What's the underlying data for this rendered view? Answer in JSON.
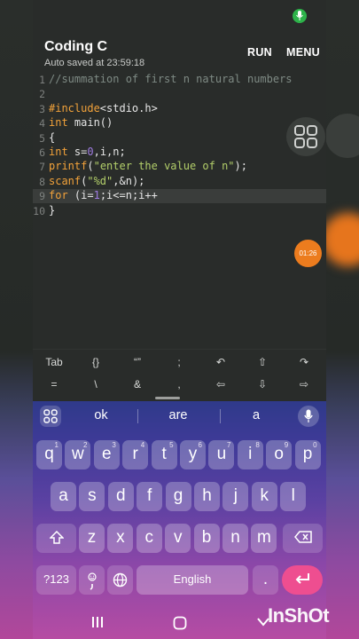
{
  "app": {
    "title": "Coding C",
    "autosave": "Auto saved at 23:59:18",
    "run_label": "RUN",
    "menu_label": "MENU",
    "accent": "#f2a23a"
  },
  "editor": {
    "active_line": 9,
    "lines": [
      {
        "n": "1",
        "segments": [
          {
            "t": "//summation of first n natural numbers",
            "c": "comment"
          }
        ]
      },
      {
        "n": "2",
        "segments": []
      },
      {
        "n": "3",
        "segments": [
          {
            "t": "#include",
            "c": "keyword"
          },
          {
            "t": "<stdio.h>",
            "c": "text"
          }
        ]
      },
      {
        "n": "4",
        "segments": [
          {
            "t": "int",
            "c": "keyword"
          },
          {
            "t": " main()",
            "c": "text"
          }
        ]
      },
      {
        "n": "5",
        "segments": [
          {
            "t": "{",
            "c": "text"
          }
        ]
      },
      {
        "n": "6",
        "segments": [
          {
            "t": "int",
            "c": "keyword"
          },
          {
            "t": " s=",
            "c": "text"
          },
          {
            "t": "0",
            "c": "number"
          },
          {
            "t": ",i,n;",
            "c": "text"
          }
        ]
      },
      {
        "n": "7",
        "segments": [
          {
            "t": "printf",
            "c": "keyword"
          },
          {
            "t": "(",
            "c": "text"
          },
          {
            "t": "\"enter the value of n\"",
            "c": "string"
          },
          {
            "t": ");",
            "c": "text"
          }
        ]
      },
      {
        "n": "8",
        "segments": [
          {
            "t": "scanf",
            "c": "keyword"
          },
          {
            "t": "(",
            "c": "text"
          },
          {
            "t": "\"%d\"",
            "c": "string"
          },
          {
            "t": ",&n);",
            "c": "text"
          }
        ]
      },
      {
        "n": "9",
        "segments": [
          {
            "t": "for",
            "c": "keyword"
          },
          {
            "t": " (i=",
            "c": "text"
          },
          {
            "t": "1",
            "c": "number"
          },
          {
            "t": ";i<=n;i++",
            "c": "text"
          }
        ]
      },
      {
        "n": "10",
        "segments": [
          {
            "t": "}",
            "c": "text"
          }
        ]
      }
    ]
  },
  "timer_label": "01:26",
  "symbols": {
    "row1": [
      "Tab",
      "{}",
      "“”",
      ";",
      "↶",
      "⇧",
      "↷"
    ],
    "row2": [
      "=",
      "\\",
      "&",
      ",",
      "⇦",
      "⇩",
      "⇨"
    ]
  },
  "keyboard": {
    "suggestions": [
      "ok",
      "are",
      "a"
    ],
    "row1": [
      {
        "k": "q",
        "h": "1"
      },
      {
        "k": "w",
        "h": "2"
      },
      {
        "k": "e",
        "h": "3"
      },
      {
        "k": "r",
        "h": "4"
      },
      {
        "k": "t",
        "h": "5"
      },
      {
        "k": "y",
        "h": "6"
      },
      {
        "k": "u",
        "h": "7"
      },
      {
        "k": "i",
        "h": "8"
      },
      {
        "k": "o",
        "h": "9"
      },
      {
        "k": "p",
        "h": "0"
      }
    ],
    "row2": [
      "a",
      "s",
      "d",
      "f",
      "g",
      "h",
      "j",
      "k",
      "l"
    ],
    "row3": [
      "z",
      "x",
      "c",
      "v",
      "b",
      "n",
      "m"
    ],
    "numbers_label": "?123",
    "space_label": "English",
    "period_label": "."
  },
  "watermark": "InShOt"
}
